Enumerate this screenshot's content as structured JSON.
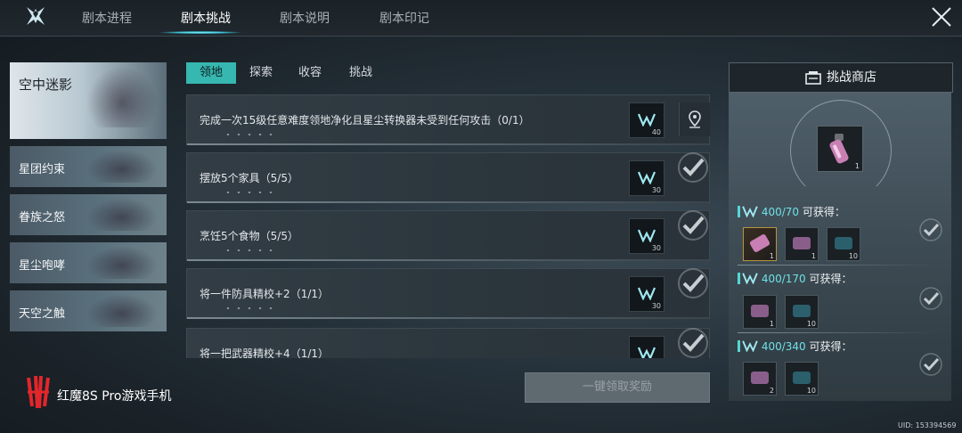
{
  "tabs": [
    "剧本进程",
    "剧本挑战",
    "剧本说明",
    "剧本印记"
  ],
  "active_tab": "剧本挑战",
  "stories": [
    "空中迷影",
    "星团约束",
    "眷族之怒",
    "星尘咆哮",
    "天空之触"
  ],
  "sub_tabs": [
    "领地",
    "探索",
    "收容",
    "挑战"
  ],
  "tasks": [
    {
      "text": "完成一次15级任意难度领地净化且星尘转换器未受到任何攻击（0/1）",
      "reward": "40"
    },
    {
      "text": "摆放5个家具（5/5）",
      "reward": "30"
    },
    {
      "text": "烹饪5个食物（5/5）",
      "reward": "30"
    },
    {
      "text": "将一件防具精校+2（1/1）",
      "reward": "30"
    },
    {
      "text": "将一把武器精校+4（1/1）",
      "reward": ""
    }
  ],
  "claim_all": "一键领取奖励",
  "shop": {
    "button": "挑战商店",
    "featured_qty": "1",
    "tiers": [
      {
        "value": "400/70",
        "suffix": "可获得：",
        "items": [
          "1",
          "1",
          "10"
        ]
      },
      {
        "value": "400/170",
        "suffix": "可获得：",
        "items": [
          "1",
          "10"
        ]
      },
      {
        "value": "400/340",
        "suffix": "可获得：",
        "items": [
          "2",
          "10"
        ]
      }
    ]
  },
  "brand": "红魔8S Pro游戏手机",
  "uid": "UID: 153394569",
  "colors": {
    "accent": "#36b7b0",
    "token": "#6fe0e6"
  }
}
